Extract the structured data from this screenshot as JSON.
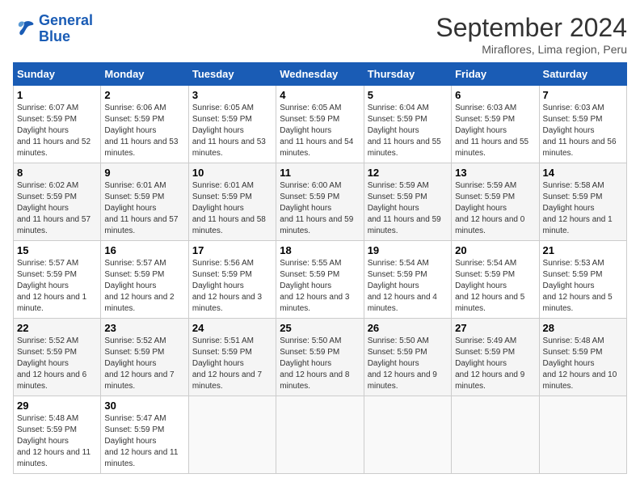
{
  "logo": {
    "line1": "General",
    "line2": "Blue"
  },
  "title": "September 2024",
  "location": "Miraflores, Lima region, Peru",
  "days_header": [
    "Sunday",
    "Monday",
    "Tuesday",
    "Wednesday",
    "Thursday",
    "Friday",
    "Saturday"
  ],
  "weeks": [
    [
      {
        "day": "1",
        "sunrise": "6:07 AM",
        "sunset": "5:59 PM",
        "daylight": "11 hours and 52 minutes."
      },
      {
        "day": "2",
        "sunrise": "6:06 AM",
        "sunset": "5:59 PM",
        "daylight": "11 hours and 53 minutes."
      },
      {
        "day": "3",
        "sunrise": "6:05 AM",
        "sunset": "5:59 PM",
        "daylight": "11 hours and 53 minutes."
      },
      {
        "day": "4",
        "sunrise": "6:05 AM",
        "sunset": "5:59 PM",
        "daylight": "11 hours and 54 minutes."
      },
      {
        "day": "5",
        "sunrise": "6:04 AM",
        "sunset": "5:59 PM",
        "daylight": "11 hours and 55 minutes."
      },
      {
        "day": "6",
        "sunrise": "6:03 AM",
        "sunset": "5:59 PM",
        "daylight": "11 hours and 55 minutes."
      },
      {
        "day": "7",
        "sunrise": "6:03 AM",
        "sunset": "5:59 PM",
        "daylight": "11 hours and 56 minutes."
      }
    ],
    [
      {
        "day": "8",
        "sunrise": "6:02 AM",
        "sunset": "5:59 PM",
        "daylight": "11 hours and 57 minutes."
      },
      {
        "day": "9",
        "sunrise": "6:01 AM",
        "sunset": "5:59 PM",
        "daylight": "11 hours and 57 minutes."
      },
      {
        "day": "10",
        "sunrise": "6:01 AM",
        "sunset": "5:59 PM",
        "daylight": "11 hours and 58 minutes."
      },
      {
        "day": "11",
        "sunrise": "6:00 AM",
        "sunset": "5:59 PM",
        "daylight": "11 hours and 59 minutes."
      },
      {
        "day": "12",
        "sunrise": "5:59 AM",
        "sunset": "5:59 PM",
        "daylight": "11 hours and 59 minutes."
      },
      {
        "day": "13",
        "sunrise": "5:59 AM",
        "sunset": "5:59 PM",
        "daylight": "12 hours and 0 minutes."
      },
      {
        "day": "14",
        "sunrise": "5:58 AM",
        "sunset": "5:59 PM",
        "daylight": "12 hours and 1 minute."
      }
    ],
    [
      {
        "day": "15",
        "sunrise": "5:57 AM",
        "sunset": "5:59 PM",
        "daylight": "12 hours and 1 minute."
      },
      {
        "day": "16",
        "sunrise": "5:57 AM",
        "sunset": "5:59 PM",
        "daylight": "12 hours and 2 minutes."
      },
      {
        "day": "17",
        "sunrise": "5:56 AM",
        "sunset": "5:59 PM",
        "daylight": "12 hours and 3 minutes."
      },
      {
        "day": "18",
        "sunrise": "5:55 AM",
        "sunset": "5:59 PM",
        "daylight": "12 hours and 3 minutes."
      },
      {
        "day": "19",
        "sunrise": "5:54 AM",
        "sunset": "5:59 PM",
        "daylight": "12 hours and 4 minutes."
      },
      {
        "day": "20",
        "sunrise": "5:54 AM",
        "sunset": "5:59 PM",
        "daylight": "12 hours and 5 minutes."
      },
      {
        "day": "21",
        "sunrise": "5:53 AM",
        "sunset": "5:59 PM",
        "daylight": "12 hours and 5 minutes."
      }
    ],
    [
      {
        "day": "22",
        "sunrise": "5:52 AM",
        "sunset": "5:59 PM",
        "daylight": "12 hours and 6 minutes."
      },
      {
        "day": "23",
        "sunrise": "5:52 AM",
        "sunset": "5:59 PM",
        "daylight": "12 hours and 7 minutes."
      },
      {
        "day": "24",
        "sunrise": "5:51 AM",
        "sunset": "5:59 PM",
        "daylight": "12 hours and 7 minutes."
      },
      {
        "day": "25",
        "sunrise": "5:50 AM",
        "sunset": "5:59 PM",
        "daylight": "12 hours and 8 minutes."
      },
      {
        "day": "26",
        "sunrise": "5:50 AM",
        "sunset": "5:59 PM",
        "daylight": "12 hours and 9 minutes."
      },
      {
        "day": "27",
        "sunrise": "5:49 AM",
        "sunset": "5:59 PM",
        "daylight": "12 hours and 9 minutes."
      },
      {
        "day": "28",
        "sunrise": "5:48 AM",
        "sunset": "5:59 PM",
        "daylight": "12 hours and 10 minutes."
      }
    ],
    [
      {
        "day": "29",
        "sunrise": "5:48 AM",
        "sunset": "5:59 PM",
        "daylight": "12 hours and 11 minutes."
      },
      {
        "day": "30",
        "sunrise": "5:47 AM",
        "sunset": "5:59 PM",
        "daylight": "12 hours and 11 minutes."
      },
      null,
      null,
      null,
      null,
      null
    ]
  ]
}
